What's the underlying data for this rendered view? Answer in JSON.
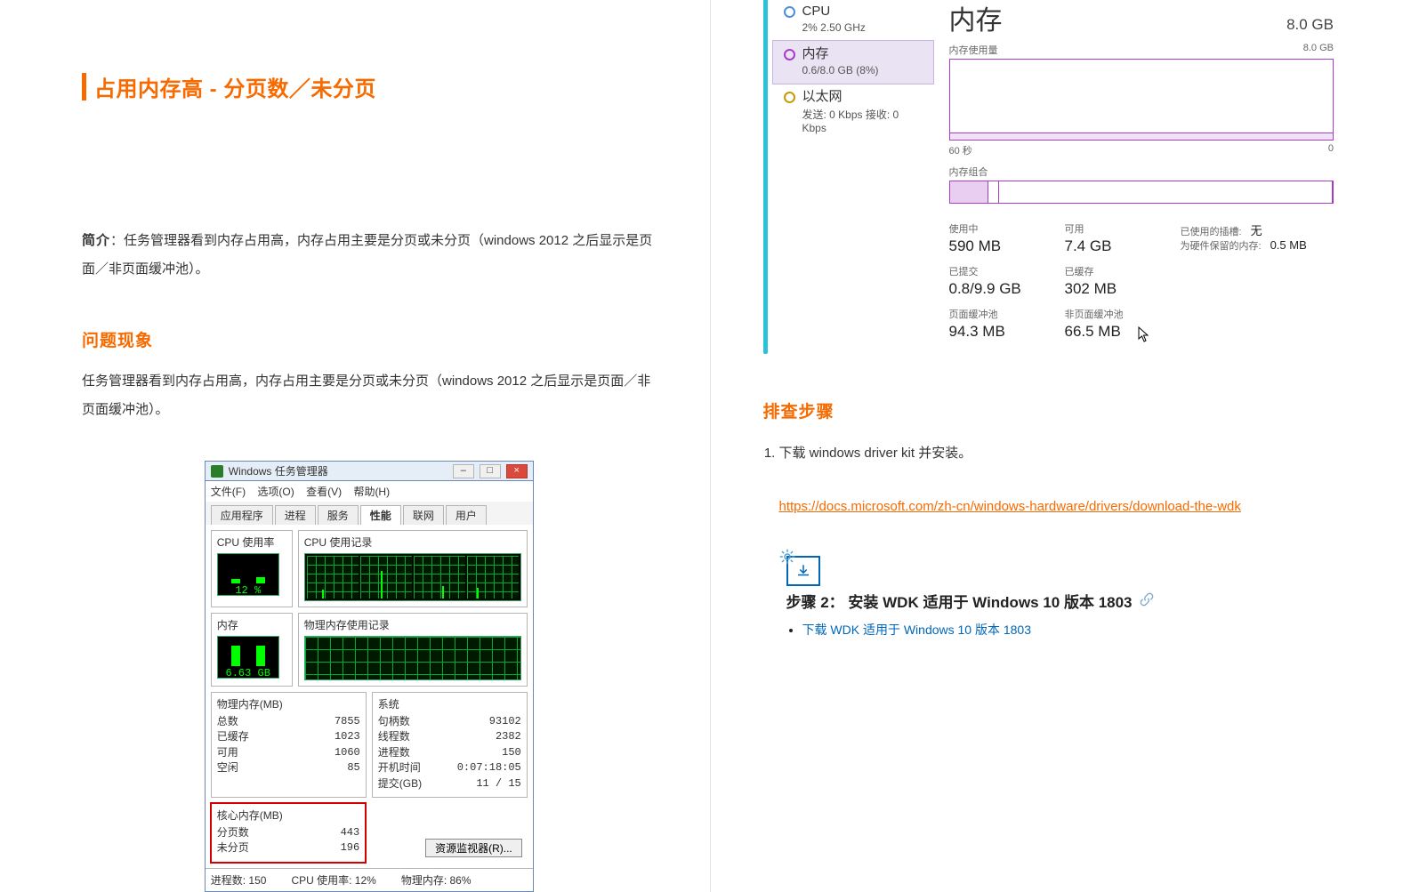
{
  "doc": {
    "title": "占用内存高 - 分页数／未分页",
    "intro_label": "简介",
    "intro_body": "：任务管理器看到内存占用高，内存占用主要是分页或未分页（windows 2012 之后显示是页面／非页面缓冲池）。",
    "section_symptom": "问题现象",
    "symptom_body": "任务管理器看到内存占用高，内存占用主要是分页或未分页（windows 2012 之后显示是页面／非页面缓冲池）。",
    "section_steps": "排查步骤",
    "step1": "下载 windows driver kit 并安装。",
    "step1_link": "https://docs.microsoft.com/zh-cn/windows-hardware/drivers/download-the-wdk"
  },
  "tm_legacy": {
    "window_title": "Windows 任务管理器",
    "menu": [
      "文件(F)",
      "选项(O)",
      "查看(V)",
      "帮助(H)"
    ],
    "tabs": [
      "应用程序",
      "进程",
      "服务",
      "性能",
      "联网",
      "用户"
    ],
    "active_tab": "性能",
    "cpu_label": "CPU 使用率",
    "cpu_hist_label": "CPU 使用记录",
    "cpu_pct": "12 %",
    "mem_label": "内存",
    "mem_hist_label": "物理内存使用记录",
    "mem_value": "6.63 GB",
    "phys_title": "物理内存(MB)",
    "phys": [
      {
        "k": "总数",
        "v": "7855"
      },
      {
        "k": "已缓存",
        "v": "1023"
      },
      {
        "k": "可用",
        "v": "1060"
      },
      {
        "k": "空闲",
        "v": "85"
      }
    ],
    "kernel_title": "核心内存(MB)",
    "kernel": [
      {
        "k": "分页数",
        "v": "443"
      },
      {
        "k": "未分页",
        "v": "196"
      }
    ],
    "sys_title": "系统",
    "sys": [
      {
        "k": "句柄数",
        "v": "93102"
      },
      {
        "k": "线程数",
        "v": "2382"
      },
      {
        "k": "进程数",
        "v": "150"
      },
      {
        "k": "开机时间",
        "v": "0:07:18:05"
      },
      {
        "k": "提交(GB)",
        "v": "11 / 15"
      }
    ],
    "res_btn": "资源监视器(R)...",
    "status": [
      "进程数: 150",
      "CPU 使用率: 12%",
      "物理内存: 86%"
    ]
  },
  "tm_modern": {
    "nav": {
      "cpu": {
        "title": "CPU",
        "sub": "2%  2.50 GHz"
      },
      "mem": {
        "title": "内存",
        "sub": "0.6/8.0 GB (8%)"
      },
      "net": {
        "title": "以太网",
        "sub": "发送: 0 Kbps  接收: 0 Kbps"
      }
    },
    "pane": {
      "title": "内存",
      "total": "8.0 GB",
      "y_top_label": "内存使用量",
      "y_top_max": "8.0 GB",
      "x_left": "60 秒",
      "x_right": "0",
      "slab_label": "内存组合",
      "stats": {
        "used": {
          "lbl": "使用中",
          "val": "590 MB"
        },
        "avail": {
          "lbl": "可用",
          "val": "7.4 GB"
        },
        "commit": {
          "lbl": "已提交",
          "val": "0.8/9.9 GB"
        },
        "cached": {
          "lbl": "已缓存",
          "val": "302 MB"
        },
        "paged": {
          "lbl": "页面缓冲池",
          "val": "94.3 MB"
        },
        "nonpaged": {
          "lbl": "非页面缓冲池",
          "val": "66.5 MB"
        },
        "slots": {
          "lbl": "已使用的插槽:",
          "val": "无"
        },
        "hwres": {
          "lbl": "为硬件保留的内存:",
          "val": "0.5 MB"
        }
      }
    }
  },
  "ms": {
    "step_title": "步骤 2： 安装 WDK 适用于 Windows 10 版本 1803",
    "dl_text": "下载 WDK 适用于 Windows 10 版本 1803"
  }
}
